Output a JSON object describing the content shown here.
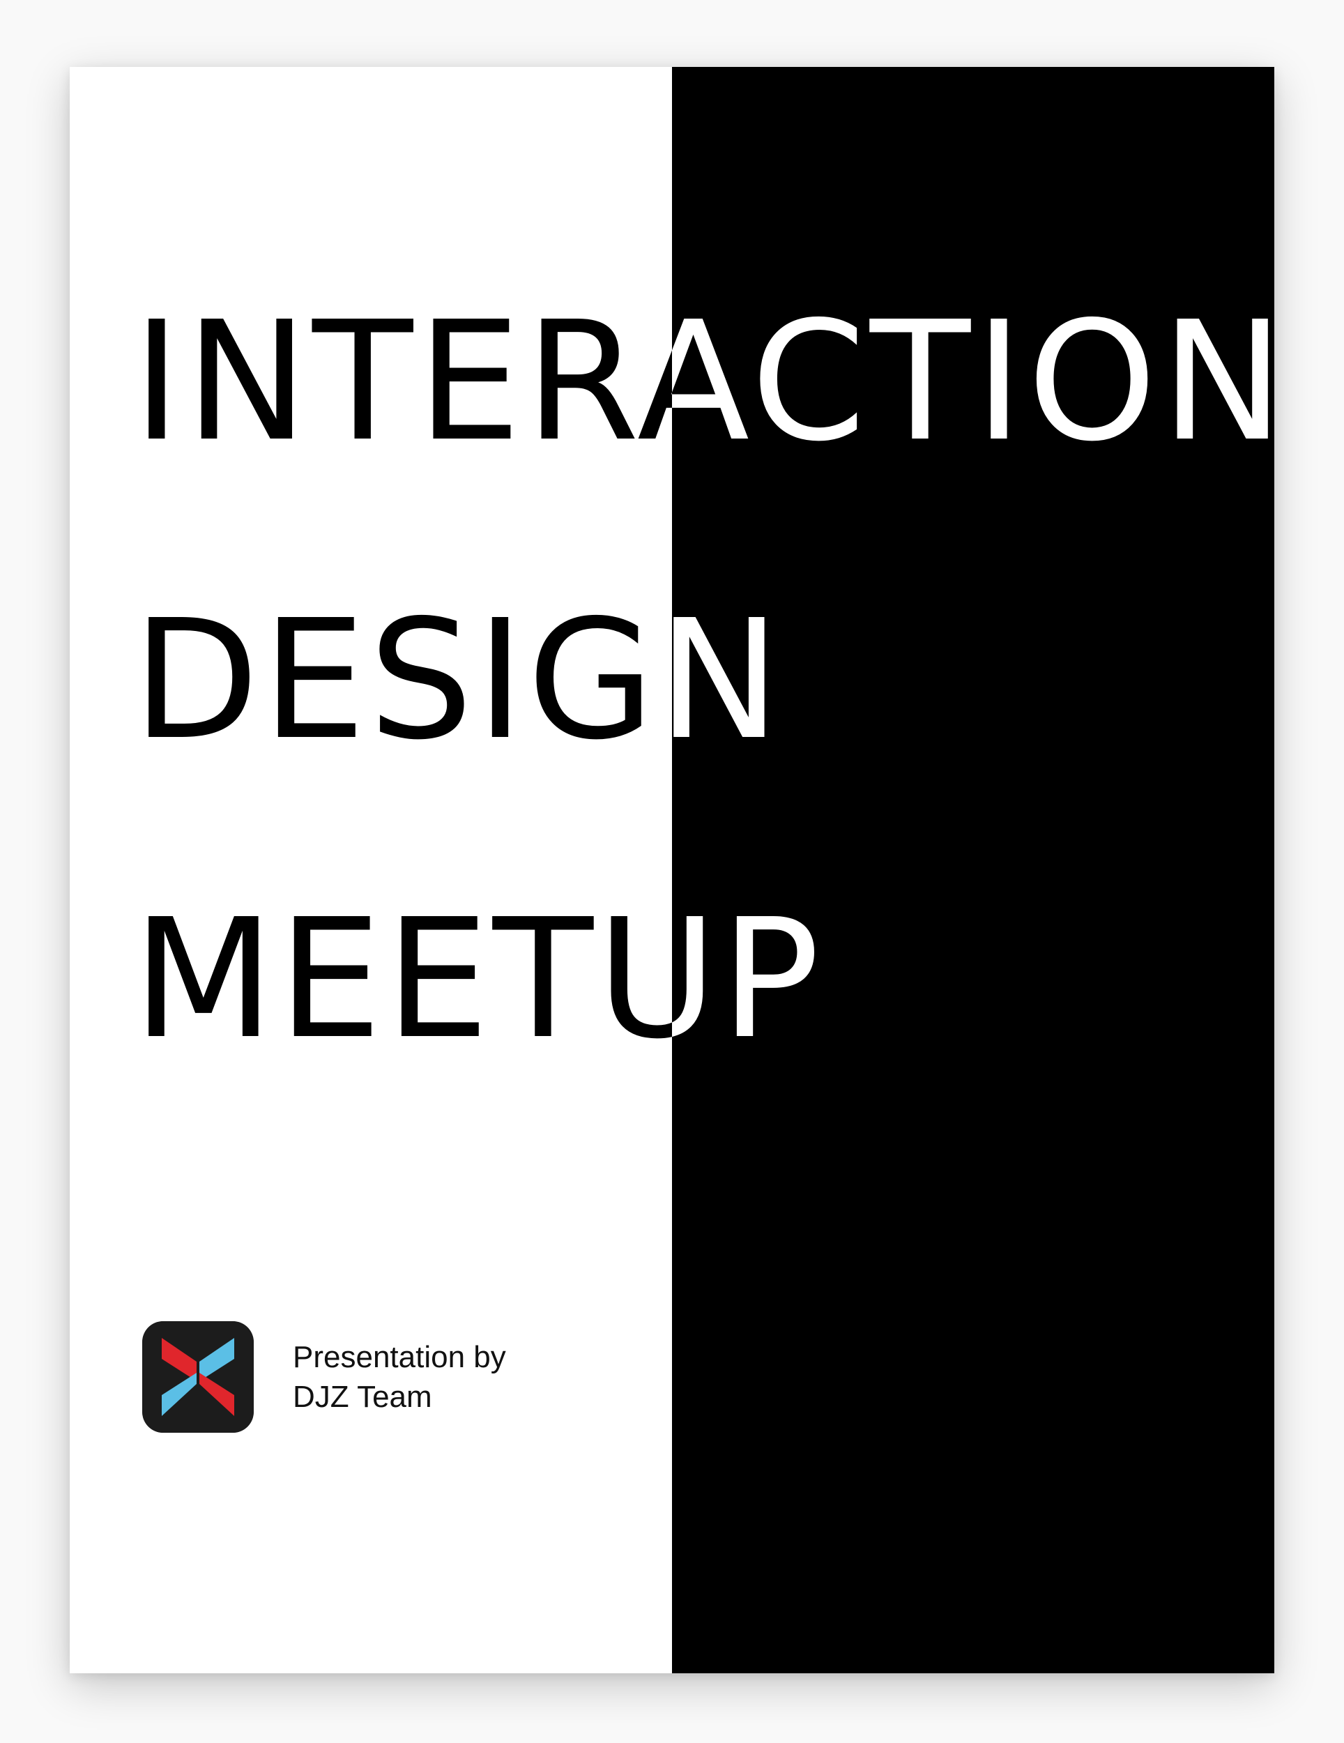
{
  "poster": {
    "title_lines": [
      "INTERACTION",
      "DESIGN",
      "MEETUP"
    ],
    "credit": {
      "line1": "Presentation by",
      "line2": "DJZ Team"
    },
    "logo_icon": "djz-x-logo-icon",
    "colors": {
      "background_left": "#ffffff",
      "background_right": "#000000",
      "logo_background": "#1c1c1c",
      "logo_red": "#e0262c",
      "logo_blue": "#5bbfe6"
    }
  }
}
